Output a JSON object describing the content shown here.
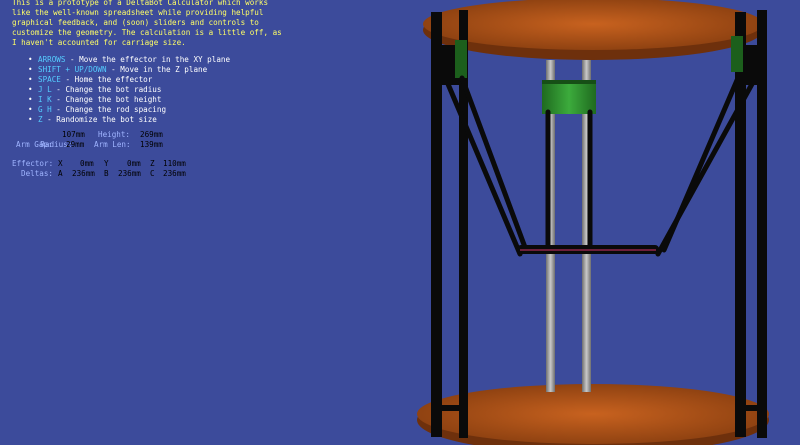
{
  "intro_text": "This is a prototype of a DeltaBot Calculator which works\nlike the well-known spreadsheet while providing helpful\ngraphical feedback, and (soon) sliders and controls to\ncustomize the geometry. The calculation is a little off, as\nI haven't accounted for carriage size.",
  "help": [
    {
      "key": "ARROWS",
      "desc": "- Move the effector in the XY plane"
    },
    {
      "key": "SHIFT + UP/DOWN",
      "desc": "- Move in the Z plane"
    },
    {
      "key": "SPACE",
      "desc": "- Home the effector"
    },
    {
      "key": "J L",
      "desc": "- Change the bot radius"
    },
    {
      "key": "I K",
      "desc": "- Change the bot height"
    },
    {
      "key": "G H",
      "desc": "- Change the rod spacing"
    },
    {
      "key": "Z",
      "desc": "- Randomize the bot size"
    }
  ],
  "dimensions": {
    "radius_label": "Radius:",
    "radius_value": "107mm",
    "height_label": "Height:",
    "height_value": "269mm",
    "arm_gap_label": "Arm Gap:",
    "arm_gap_value": "29mm",
    "arm_len_label": "Arm Len:",
    "arm_len_value": "139mm"
  },
  "effector": {
    "label": "Effector:",
    "x_label": "X",
    "x_value": "0mm",
    "y_label": "Y",
    "y_value": "0mm",
    "z_label": "Z",
    "z_value": "110mm"
  },
  "deltas": {
    "label": "Deltas:",
    "a_label": "A",
    "a_value": "236mm",
    "b_label": "B",
    "b_value": "236mm",
    "c_label": "C",
    "c_value": "236mm"
  },
  "colors": {
    "background": "#3c4b9b",
    "plate": "#c8621f",
    "frame": "#0c0c0c",
    "carriage": "#2d8a2d",
    "rod": "#9a9a9a",
    "intro_text": "#ffff66",
    "key_text": "#55ccff",
    "label_text": "#9fb4ff"
  }
}
